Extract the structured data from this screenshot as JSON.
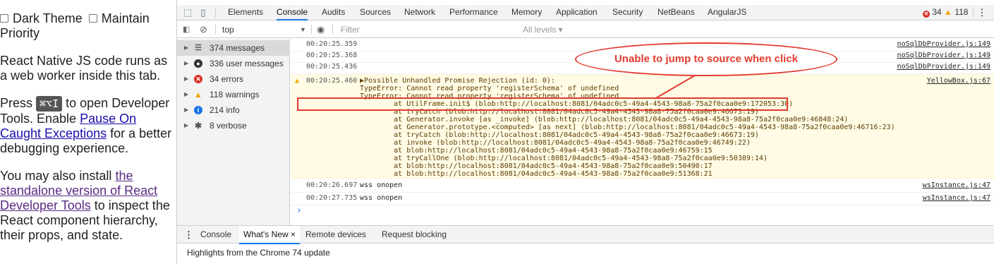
{
  "left": {
    "checkbox1_label": "Dark Theme",
    "checkbox2_label": "Maintain Priority",
    "para1": "React Native JS code runs as a web worker inside this tab.",
    "para2_pre": "Press",
    "shortcut": "⌘⌥I",
    "para2_mid": "to open Developer Tools. Enable",
    "pause_link": "Pause On Caught Exceptions",
    "para2_post": "for a better debugging experience.",
    "para3_pre": "You may also install",
    "standalone_link": "the standalone version of React Developer Tools",
    "para3_post": "to inspect the React component hierarchy, their props, and state."
  },
  "tabs": [
    "Elements",
    "Console",
    "Audits",
    "Sources",
    "Network",
    "Performance",
    "Memory",
    "Application",
    "Security",
    "NetBeans",
    "AngularJS"
  ],
  "active_tab": "Console",
  "badges": {
    "errors": "34",
    "warnings": "118"
  },
  "toolbar": {
    "context": "top",
    "filter_placeholder": "Filter",
    "levels": "All levels ▾"
  },
  "sidebar": [
    {
      "label": "374 messages",
      "icon": "list-icon",
      "selected": true
    },
    {
      "label": "336 user messages",
      "icon": "user-icon"
    },
    {
      "label": "34 errors",
      "icon": "error-icon"
    },
    {
      "label": "118 warnings",
      "icon": "warning-icon"
    },
    {
      "label": "214 info",
      "icon": "info-icon"
    },
    {
      "label": "8 verbose",
      "icon": "bug-icon"
    }
  ],
  "console": {
    "rows": [
      {
        "time": "00:20:25.359",
        "text": "",
        "source": "noSqlDbProvider.js:149"
      },
      {
        "time": "00:20:25.368",
        "text": "",
        "source": "noSqlDbProvider.js:149"
      },
      {
        "time": "00:20:25.436",
        "text": "",
        "source": "noSqlDbProvider.js:149"
      }
    ],
    "warning": {
      "time": "00:20:25.460",
      "source": "YellowBox.js:67",
      "lines": [
        "▶Possible Unhandled Promise Rejection (id: 0):",
        "TypeError: Cannot read property 'registerSchema' of undefined",
        "TypeError: Cannot read property 'registerSchema' of undefined",
        "        at UtilFrame.init$ (blob:http://localhost:8081/04adc0c5-49a4-4543-98a8-75a2f0caa0e9:172053:30)",
        "        at tryCatch (blob:http://localhost:8081/04adc0c5-49a4-4543-98a8-75a2f0caa0e9:46673:19)",
        "        at Generator.invoke [as _invoke] (blob:http://localhost:8081/04adc0c5-49a4-4543-98a8-75a2f0caa0e9:46848:24)",
        "        at Generator.prototype.<computed> [as next] (blob:http://localhost:8081/04adc0c5-49a4-4543-98a8-75a2f0caa0e9:46716:23)",
        "        at tryCatch (blob:http://localhost:8081/04adc0c5-49a4-4543-98a8-75a2f0caa0e9:46673:19)",
        "        at invoke (blob:http://localhost:8081/04adc0c5-49a4-4543-98a8-75a2f0caa0e9:46749:22)",
        "        at blob:http://localhost:8081/04adc0c5-49a4-4543-98a8-75a2f0caa0e9:46759:15",
        "        at tryCallOne (blob:http://localhost:8081/04adc0c5-49a4-4543-98a8-75a2f0caa0e9:50389:14)",
        "        at blob:http://localhost:8081/04adc0c5-49a4-4543-98a8-75a2f0caa0e9:50490:17",
        "        at blob:http://localhost:8081/04adc0c5-49a4-4543-98a8-75a2f0caa0e9:51368:21"
      ]
    },
    "after_rows": [
      {
        "time": "00:20:26.697",
        "text": "wss onopen",
        "source": "wsInstance.js:47"
      },
      {
        "time": "00:20:27.735",
        "text": "wss onopen",
        "source": "wsInstance.js:47"
      }
    ],
    "prompt": "›"
  },
  "annotation": {
    "callout": "Unable to jump to source when click",
    "color": "#e23b2e"
  },
  "drawer": {
    "tabs": [
      "Console",
      "What's New",
      "Remote devices",
      "Request blocking"
    ],
    "active": "What's New",
    "body": "Highlights from the Chrome 74 update"
  }
}
